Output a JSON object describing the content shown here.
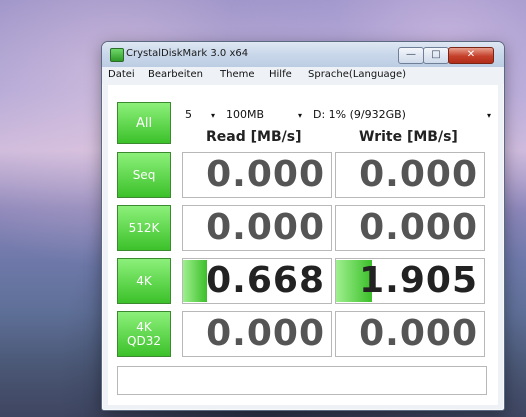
{
  "window": {
    "title": "CrystalDiskMark 3.0 x64",
    "min_glyph": "—",
    "max_glyph": "□",
    "close_glyph": "✕"
  },
  "menu": [
    "Datei",
    "Bearbeiten",
    "Theme",
    "Hilfe",
    "Sprache(Language)"
  ],
  "controls": {
    "all_label": "All",
    "count": "5",
    "size": "100MB",
    "drive": "D: 1% (9/932GB)",
    "dropdown_glyph": "▾"
  },
  "columns": {
    "read": "Read [MB/s]",
    "write": "Write [MB/s]"
  },
  "rows": [
    {
      "label": "Seq",
      "read": "0.000",
      "write": "0.000",
      "read_fill": 0,
      "write_fill": 0
    },
    {
      "label": "512K",
      "read": "0.000",
      "write": "0.000",
      "read_fill": 0,
      "write_fill": 0
    },
    {
      "label": "4K",
      "read": "0.668",
      "write": "1.905",
      "read_fill": 0.16,
      "write_fill": 0.24
    },
    {
      "label": "4K\nQD32",
      "read": "0.000",
      "write": "0.000",
      "read_fill": 0,
      "write_fill": 0
    }
  ],
  "status": "",
  "colors": {
    "accent_green": "#3cc12a",
    "close_red": "#c4402a"
  }
}
